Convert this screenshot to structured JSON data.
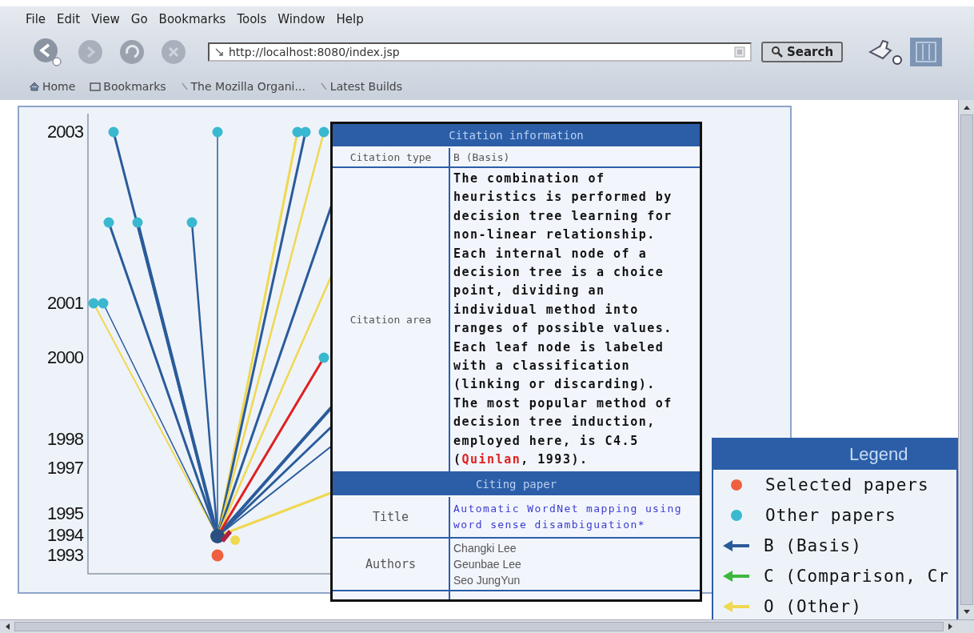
{
  "menu": [
    "File",
    "Edit",
    "View",
    "Go",
    "Bookmarks",
    "Tools",
    "Window",
    "Help"
  ],
  "toolbar": {
    "url": "http://localhost:8080/index.jsp",
    "search_button": "Search"
  },
  "bookmarks": [
    {
      "label": "Home",
      "kind": "home"
    },
    {
      "label": "Bookmarks",
      "kind": "folder"
    },
    {
      "label": "The Mozilla Organi...",
      "kind": "link"
    },
    {
      "label": "Latest Builds",
      "kind": "link"
    }
  ],
  "graph": {
    "year_labels": [
      "2003",
      "2001",
      "2000",
      "1998",
      "1997",
      "1995",
      "1994",
      "1993"
    ]
  },
  "citation_popup": {
    "header": "Citation information",
    "type_label": "Citation type",
    "type_value": "B (Basis)",
    "area_label": "Citation area",
    "area_text_before": "The combination of heuristics is performed by decision tree learning for non-linear relationship. Each internal node of a decision tree is a choice point, dividing an individual method into ranges of possible values. Each leaf node is labeled with a classification (linking or discarding). The most popular method of decision tree induction, employed here, is C4.5 (",
    "area_link": "Quinlan",
    "area_text_after": ", 1993).",
    "citing_header": "Citing paper",
    "title_label": "Title",
    "title_value": "Automatic WordNet mapping using word sense disambiguation*",
    "authors_label": "Authors",
    "authors": [
      "Changki Lee",
      "Geunbae Lee",
      "Seo JungYun"
    ]
  },
  "legend": {
    "title": "Legend",
    "items": [
      {
        "kind": "dot",
        "color": "#f06040",
        "label": "Selected papers"
      },
      {
        "kind": "dot",
        "color": "#3ab8d0",
        "label": "Other papers"
      },
      {
        "kind": "arrow",
        "color": "#2a5b9a",
        "label": "B (Basis)"
      },
      {
        "kind": "arrow",
        "color": "#3cb83c",
        "label": "C (Comparison, Cr"
      },
      {
        "kind": "arrow",
        "color": "#f0d850",
        "label": "O (Other)"
      }
    ]
  }
}
